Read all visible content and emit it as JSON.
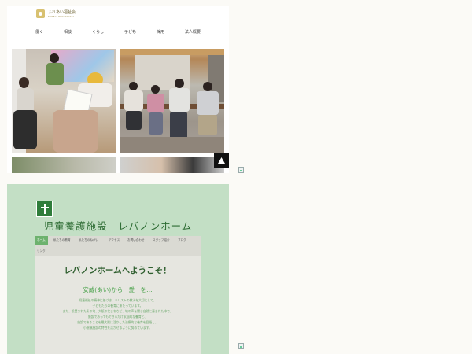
{
  "site": {
    "logo_name": "ふれあい福祉会",
    "logo_sub": "FUREAI FUKUSHIKAI"
  },
  "nav": {
    "items": [
      {
        "label": "働く"
      },
      {
        "label": "相談"
      },
      {
        "label": "くらし"
      },
      {
        "label": "子ども"
      },
      {
        "label": "採用"
      },
      {
        "label": "法人概要"
      }
    ]
  },
  "scroll_top": {
    "icon": "triangle-up-icon"
  },
  "facility": {
    "title": "児童養護施設　レバノンホーム",
    "tabs": [
      {
        "label": "ホーム"
      },
      {
        "label": "私たちの教育"
      },
      {
        "label": "私たちのねがい"
      },
      {
        "label": "アクセス"
      },
      {
        "label": "お問い合わせ"
      },
      {
        "label": "スタッフ紹介"
      },
      {
        "label": "ブログ"
      },
      {
        "label": "リンク"
      }
    ],
    "welcome": "レバノンホームへようこそ！",
    "motto": "安威(あい)から　愛　を…",
    "description": [
      "児童福祉の精神に基づき、キリストの教えを大切にして、",
      "子どもたちの養育にあたっています。",
      "また、設置されたその地、大阪の北まちなど、地の声を聞き自然に恵まれた中で、",
      "施設であってもできるだけ家庭的な養育と、",
      "施設であることを最大限に活かした治療的な養育を目指し、",
      "小規模施設の特性を活かせるように努めています。"
    ]
  },
  "colors": {
    "accent_green": "#2f6d35",
    "tab_active": "#6db26e",
    "card_bg": "#c3dfc5"
  }
}
